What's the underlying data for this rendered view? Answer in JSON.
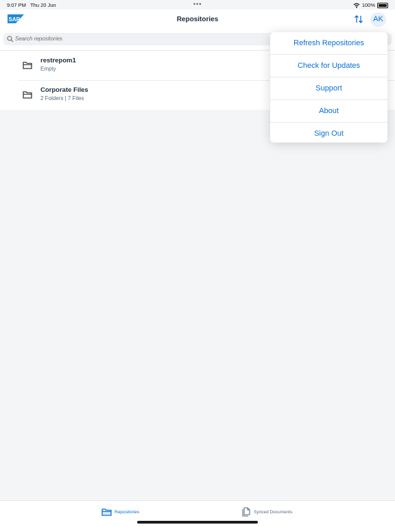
{
  "status_bar": {
    "time": "9:07 PM",
    "date": "Thu 20 Jun",
    "battery": "100%",
    "dots": "•••"
  },
  "header": {
    "logo_text": "SAP",
    "title": "Repositories",
    "avatar_initials": "AK"
  },
  "search": {
    "placeholder": "Search repositories"
  },
  "repositories": [
    {
      "name": "restrepom1",
      "detail": "Empty"
    },
    {
      "name": "Corporate Files",
      "detail": "2 Folders | 7 Files"
    }
  ],
  "menu": {
    "refresh": "Refresh Repositories",
    "updates": "Check for Updates",
    "support": "Support",
    "about": "About",
    "sign_out": "Sign Out"
  },
  "tabs": {
    "repositories": "Repositories",
    "synced": "Synced Documents"
  },
  "colors": {
    "accent": "#0a6ed1",
    "brand_logo": "#1f8ad4"
  },
  "icons": [
    "wifi-icon",
    "battery-icon",
    "sort-icon",
    "search-icon",
    "folder-icon",
    "document-stack-icon"
  ]
}
